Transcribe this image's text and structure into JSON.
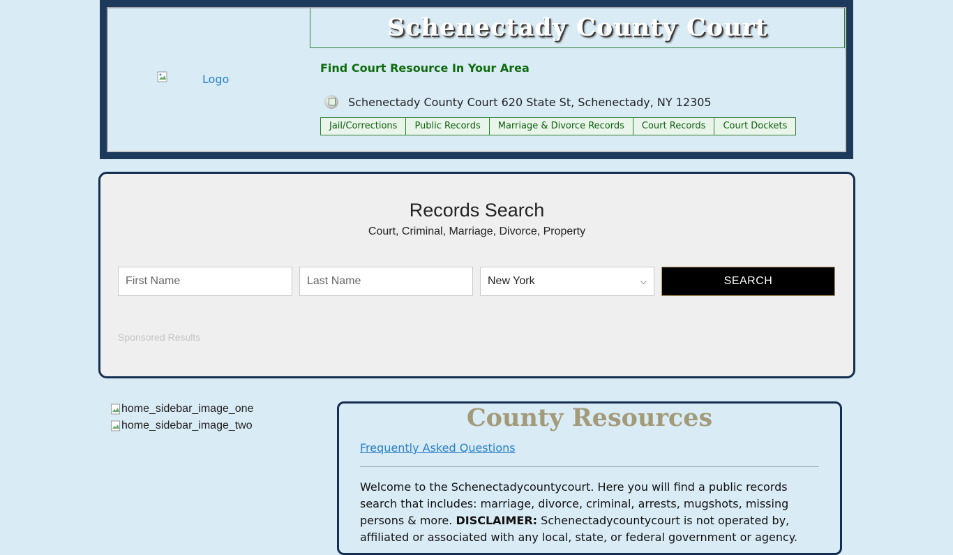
{
  "header": {
    "logo_alt": "Logo",
    "site_title": "Schenectady County Court",
    "tagline": "Find Court Resource In Your Area",
    "address": "Schenectady County Court 620 State St, Schenectady, NY 12305",
    "nav": [
      "Jail/Corrections",
      "Public Records",
      "Marriage & Divorce Records",
      "Court Records",
      "Court Dockets"
    ]
  },
  "search": {
    "title": "Records Search",
    "subtitle": "Court, Criminal, Marriage, Divorce, Property",
    "first_name_placeholder": "First Name",
    "last_name_placeholder": "Last Name",
    "state_selected": "New York",
    "button_label": "SEARCH",
    "sponsored_label": "Sponsored Results"
  },
  "sidebar": {
    "image_one_alt": "home_sidebar_image_one",
    "image_two_alt": "home_sidebar_image_two"
  },
  "resources": {
    "title": "County Resources",
    "faq_link": "Frequently Asked Questions",
    "welcome_text": "Welcome to the Schenectadycountycourt. Here you will find a public records search that includes: marriage, divorce, criminal, arrests, mugshots, missing persons & more.",
    "disclaimer_label": "DISCLAIMER:",
    "disclaimer_text": "Schenectadycountycourt is not operated by, affiliated or associated with any local, state, or federal government or agency."
  },
  "colors": {
    "page_bg": "#d9ebf5",
    "header_frame": "#1d3a5c",
    "nav_green": "#0d5e0d",
    "panel_border": "#132e50",
    "resources_title": "#a29a78"
  }
}
